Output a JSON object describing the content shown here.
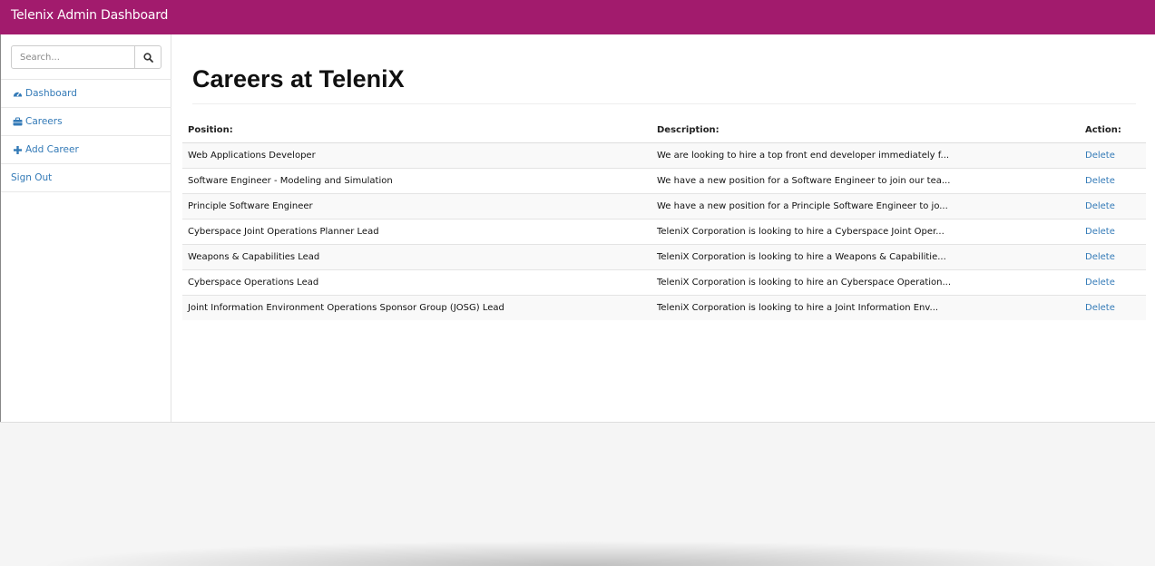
{
  "brand": "Telenix Admin Dashboard",
  "sidebar": {
    "search": {
      "placeholder": "Search...",
      "icon": "search-icon"
    },
    "items": [
      {
        "label": "Dashboard",
        "icon": "dashboard-icon"
      },
      {
        "label": "Careers",
        "icon": "briefcase-icon"
      },
      {
        "label": "Add Career",
        "icon": "plus-icon"
      },
      {
        "label": "Sign Out"
      }
    ]
  },
  "main": {
    "title": "Careers at TeleniX",
    "table": {
      "headers": [
        "Position:",
        "Description:",
        "Action:"
      ],
      "rows": [
        {
          "position": "Web Applications Developer",
          "description": "We are looking to hire a top front end developer immediately f...",
          "action": "Delete"
        },
        {
          "position": "Software Engineer - Modeling and Simulation",
          "description": "We have a new position for a Software Engineer to join our tea...",
          "action": "Delete"
        },
        {
          "position": "Principle Software Engineer",
          "description": "We have a new position for a Principle Software Engineer to jo...",
          "action": "Delete"
        },
        {
          "position": "Cyberspace Joint Operations Planner Lead",
          "description": "TeleniX Corporation is looking to hire a Cyberspace Joint Oper...",
          "action": "Delete"
        },
        {
          "position": "Weapons & Capabilities Lead",
          "description": "TeleniX Corporation is looking to hire a Weapons & Capabilitie...",
          "action": "Delete"
        },
        {
          "position": "Cyberspace Operations Lead",
          "description": "TeleniX Corporation is looking to hire an Cyberspace Operation...",
          "action": "Delete"
        },
        {
          "position": "Joint Information Environment Operations Sponsor Group (JOSG) Lead",
          "description": "TeleniX Corporation is looking to hire a Joint Information Env...",
          "action": "Delete"
        }
      ]
    }
  },
  "colors": {
    "brand_bar": "#a21b6d",
    "link": "#337ab7"
  }
}
